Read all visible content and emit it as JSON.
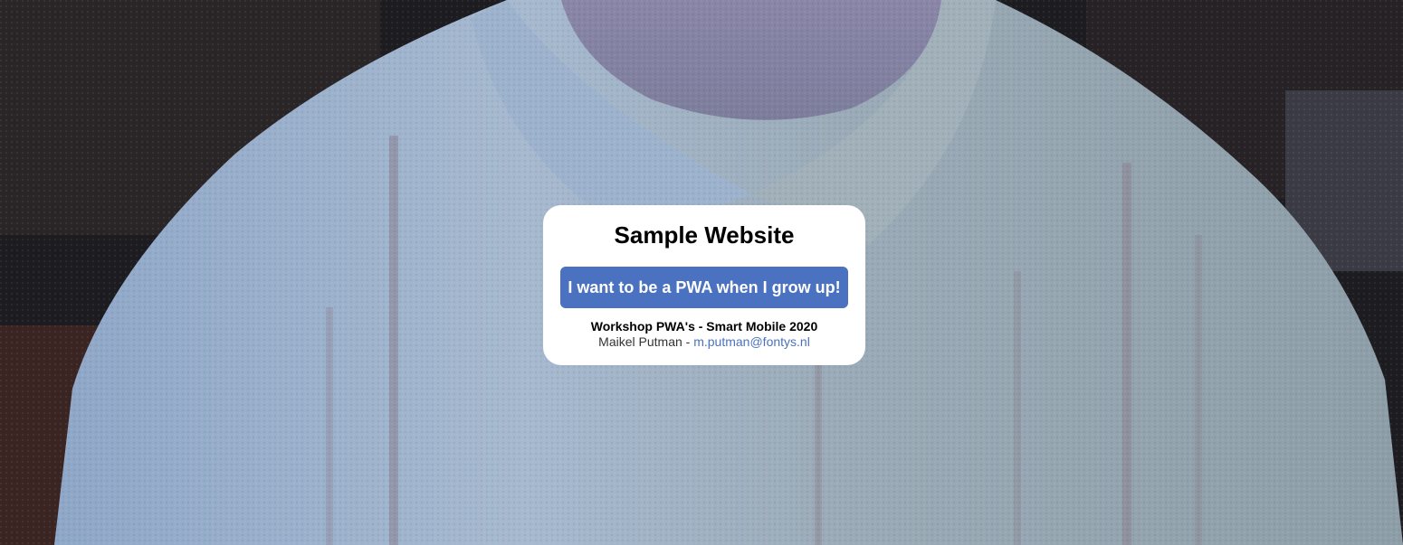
{
  "card": {
    "title": "Sample Website",
    "button_label": "I want to be a PWA when I grow up!",
    "workshop": "Workshop PWA's - Smart Mobile 2020",
    "author": "Maikel Putman",
    "separator": " - ",
    "email": "m.putman@fontys.nl"
  },
  "colors": {
    "button_background": "#4a72c0",
    "card_background": "#ffffff",
    "link": "#4a72c0"
  }
}
